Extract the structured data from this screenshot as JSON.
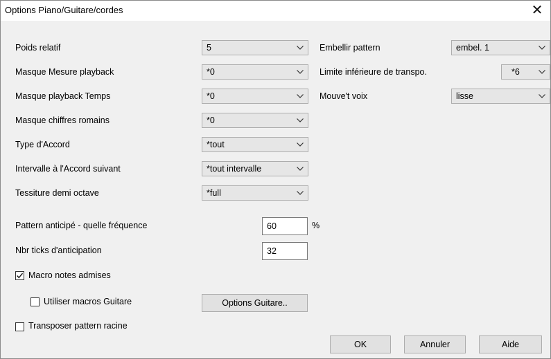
{
  "window": {
    "title": "Options Piano/Guitare/cordes",
    "close_glyph": "✕"
  },
  "left_rows": [
    {
      "label": "Poids relatif",
      "value": "5"
    },
    {
      "label": "Masque Mesure playback",
      "value": "*0"
    },
    {
      "label": "Masque playback Temps",
      "value": "*0"
    },
    {
      "label": "Masque chiffres romains",
      "value": "*0"
    },
    {
      "label": "Type d'Accord",
      "value": "*tout"
    },
    {
      "label": "Intervalle à l'Accord suivant",
      "value": "*tout intervalle"
    },
    {
      "label": "Tessiture demi octave",
      "value": "*full"
    }
  ],
  "right_rows": [
    {
      "label": "Embellir pattern",
      "value": "embel. 1"
    },
    {
      "label": "Limite inférieure de transpo.",
      "value": "*6"
    },
    {
      "label": "Mouve't voix",
      "value": "lisse"
    }
  ],
  "anticipation": {
    "frequency_label": "Pattern anticipé - quelle fréquence",
    "frequency_value": "60",
    "frequency_unit": "%",
    "ticks_label": "Nbr ticks d'anticipation",
    "ticks_value": "32"
  },
  "checkboxes": {
    "macro_notes": {
      "label": "Macro notes admises",
      "checked": true
    },
    "guitar_macros": {
      "label": "Utiliser macros Guitare",
      "checked": false
    },
    "transpose_root": {
      "label": "Transposer pattern racine",
      "checked": false
    }
  },
  "buttons": {
    "guitar_options": "Options Guitare..",
    "ok": "OK",
    "cancel": "Annuler",
    "help": "Aide"
  }
}
